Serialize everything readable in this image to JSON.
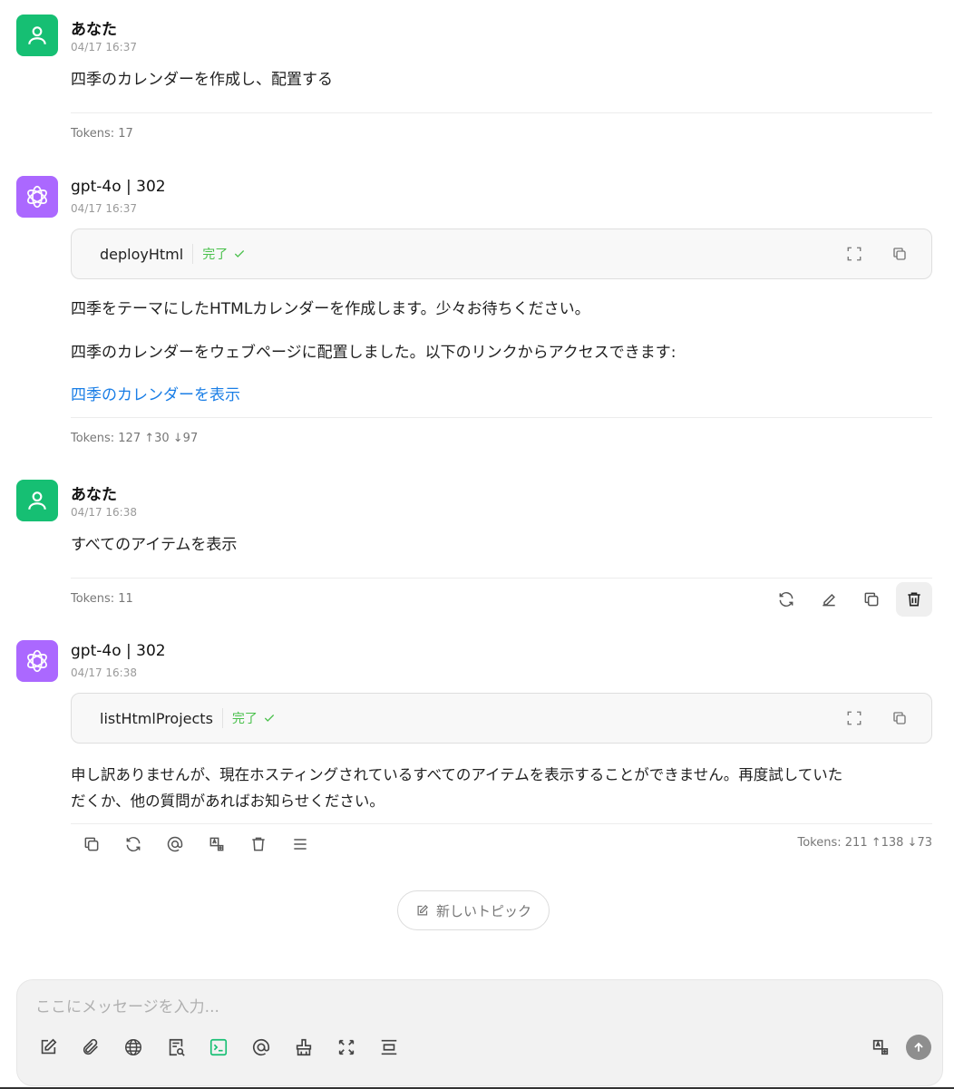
{
  "messages": [
    {
      "role": "user",
      "name": "あなた",
      "time": "04/17 16:37",
      "text": "四季のカレンダーを作成し、配置する",
      "tokens": "Tokens: 17"
    },
    {
      "role": "assistant",
      "name": "gpt-4o | 302",
      "time": "04/17 16:37",
      "tool": {
        "name": "deployHtml",
        "status": "完了"
      },
      "paragraphs": [
        "四季をテーマにしたHTMLカレンダーを作成します。少々お待ちください。",
        "四季のカレンダーをウェブページに配置しました。以下のリンクからアクセスできます:"
      ],
      "link": "四季のカレンダーを表示",
      "tokens": "Tokens: 127 ↑30 ↓97"
    },
    {
      "role": "user",
      "name": "あなた",
      "time": "04/17 16:38",
      "text": "すべてのアイテムを表示",
      "tokens": "Tokens: 11"
    },
    {
      "role": "assistant",
      "name": "gpt-4o | 302",
      "time": "04/17 16:38",
      "tool": {
        "name": "listHtmlProjects",
        "status": "完了"
      },
      "text_lines": [
        "申し訳ありませんが、現在ホスティングされているすべてのアイテムを表示することができません。再度試していた",
        "だくか、他の質問があればお知らせください。"
      ],
      "tokens": "Tokens: 211 ↑138 ↓73"
    }
  ],
  "new_topic_label": "新しいトピック",
  "composer": {
    "placeholder": "ここにメッセージを入力..."
  },
  "colors": {
    "user_avatar": "#16bf73",
    "bot_avatar": "#ab68ff",
    "link": "#1a7ee6",
    "status_done": "#49c04b"
  }
}
